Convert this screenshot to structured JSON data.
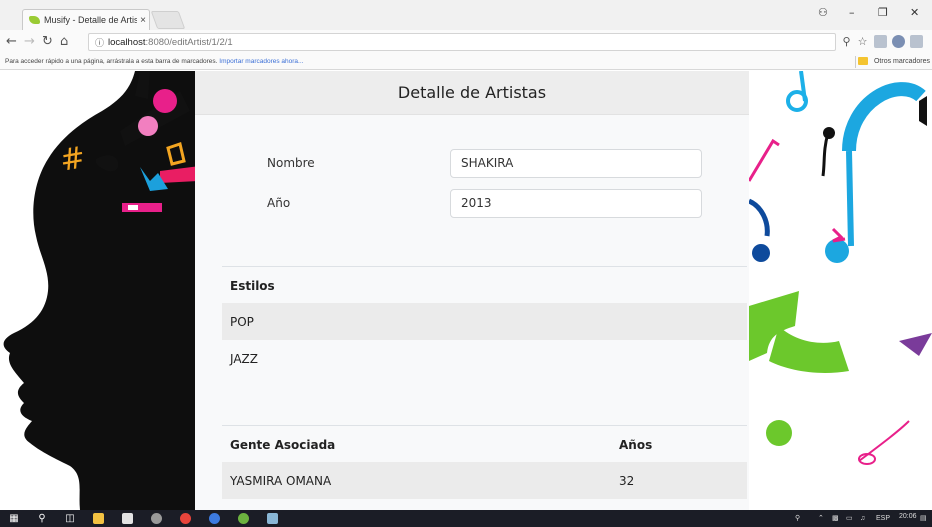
{
  "browser": {
    "tab_title": "Musify - Detalle de Artist",
    "tab_close": "×",
    "url_host": "localhost",
    "url_path": ":8080/editArtist/1/2/1",
    "bookmarks_message": "Para acceder rápido a una página, arrástrala a esta barra de marcadores.",
    "bookmarks_link": "Importar marcadores ahora...",
    "other_bookmarks": "Otros marcadores"
  },
  "card": {
    "title": "Detalle de Artistas",
    "fields": [
      {
        "label": "Nombre",
        "value": "SHAKIRA"
      },
      {
        "label": "Año",
        "value": "2013"
      }
    ],
    "styles_table": {
      "header": "Estilos",
      "rows": [
        "POP",
        "JAZZ"
      ]
    },
    "people_table": {
      "headers": [
        "Gente Asociada",
        "Años"
      ],
      "rows": [
        {
          "name": "YASMIRA OMANA",
          "years": "32"
        }
      ]
    }
  },
  "taskbar": {
    "language": "ESP",
    "time": "20:06"
  },
  "colors": {
    "card_bg": "#f8f9fa",
    "header_bg": "#ededed",
    "stripe": "#ebebeb",
    "taskbar": "#1b1d26",
    "link": "#3b6fd6"
  },
  "icons": [
    "leaf-favicon-icon",
    "back-icon",
    "forward-icon",
    "reload-icon",
    "home-icon",
    "info-icon",
    "zoom-icon",
    "star-icon",
    "extension-icon",
    "profile-icon",
    "minimize-icon",
    "restore-icon",
    "close-icon",
    "folder-icon",
    "windows-start-icon",
    "search-icon",
    "task-view-icon",
    "file-explorer-icon",
    "store-icon",
    "chrome-icon",
    "network-icon",
    "volume-icon"
  ]
}
